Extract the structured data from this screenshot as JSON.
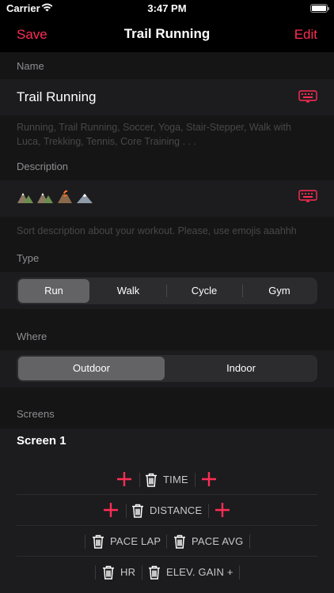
{
  "status_bar": {
    "carrier": "Carrier",
    "time": "3:47 PM"
  },
  "nav": {
    "save": "Save",
    "title": "Trail Running",
    "edit": "Edit"
  },
  "name_section": {
    "label": "Name",
    "value": "Trail Running",
    "hint": "Running, Trail Running, Soccer, Yoga, Stair-Stepper, Walk with Luca, Trekking, Tennis, Core Training . . ."
  },
  "description_section": {
    "label": "Description",
    "value_icons": [
      "mountain-icon",
      "mountain-icon",
      "volcano-icon",
      "snow-mountain-icon"
    ],
    "hint": "Sort description about your workout. Please, use emojis aaahhh"
  },
  "type_section": {
    "label": "Type",
    "options": [
      "Run",
      "Walk",
      "Cycle",
      "Gym"
    ],
    "selected": "Run"
  },
  "where_section": {
    "label": "Where",
    "options": [
      "Outdoor",
      "Indoor"
    ],
    "selected": "Outdoor"
  },
  "screens_section": {
    "label": "Screens",
    "screen_title": "Screen 1",
    "rows": [
      {
        "items": [
          "TIME"
        ]
      },
      {
        "items": [
          "DISTANCE"
        ]
      },
      {
        "items": [
          "PACE LAP",
          "PACE AVG"
        ]
      },
      {
        "items": [
          "HR",
          "ELEV. GAIN +"
        ]
      }
    ]
  },
  "colors": {
    "accent": "#ff2d55",
    "background": "#000000",
    "cell": "#1c1c1e"
  }
}
